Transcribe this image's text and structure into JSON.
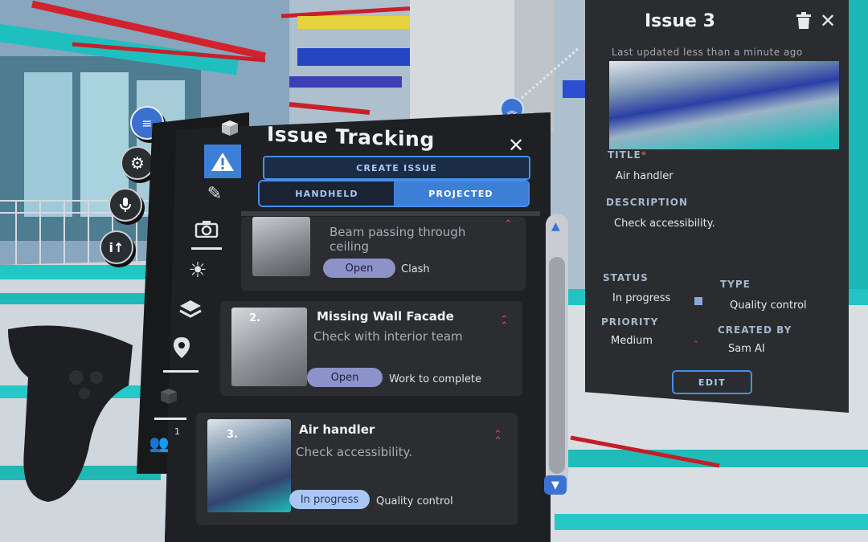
{
  "left_toolbar": {
    "buttons": [
      "notes-icon",
      "settings-icon",
      "microphone-icon",
      "info-icon"
    ]
  },
  "issue_panel": {
    "title": "Issue Tracking",
    "create_label": "CREATE ISSUE",
    "seg_handheld": "HANDHELD",
    "seg_projected": "PROJECTED",
    "selected_mode": "PROJECTED",
    "sidebar": {
      "icons": [
        "cube-icon",
        "warning-icon",
        "ruler-pencil-icon",
        "camera-icon",
        "sun-icon",
        "layers-icon",
        "location-pin-icon",
        "box-icon",
        "users-icon"
      ],
      "users_count": "1"
    },
    "issues": [
      {
        "number": "",
        "title": "",
        "subtitle": "Beam passing through ceiling",
        "subtitle_line1": "Beam passing through",
        "subtitle_line2": "ceiling",
        "status": "Open",
        "type": "Clash"
      },
      {
        "number": "2.",
        "title": "Missing Wall Facade",
        "subtitle": "Check with interior team",
        "status": "Open",
        "type": "Work to complete"
      },
      {
        "number": "3.",
        "title": "Air handler",
        "subtitle": "Check accessibility.",
        "status": "In progress",
        "type": "Quality control"
      }
    ]
  },
  "detail": {
    "title": "Issue 3",
    "updated": "Last updated less than a minute ago",
    "title_label": "TITLE",
    "required_mark": "*",
    "title_value": "Air handler",
    "description_label": "DESCRIPTION",
    "description_value": "Check accessibility.",
    "status_label": "STATUS",
    "status_value": "In progress",
    "type_label": "TYPE",
    "type_value": "Quality control",
    "priority_label": "PRIORITY",
    "priority_value": "Medium",
    "created_label": "CREATED BY",
    "created_value": "Sam AI",
    "edit_label": "EDIT"
  },
  "colors": {
    "accent": "#4a8de6",
    "priority": "#e8454a",
    "open_pill": "#8d92c9",
    "progress_pill": "#a9c7f0"
  }
}
